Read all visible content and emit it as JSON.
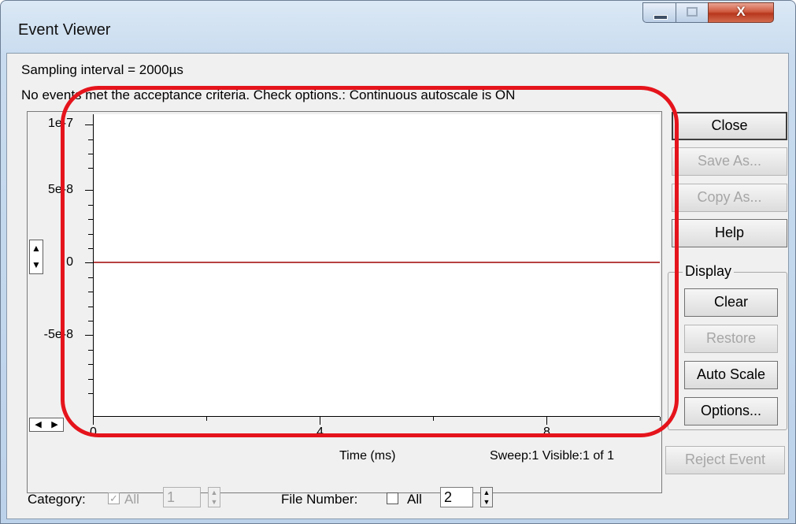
{
  "window": {
    "title": "Event Viewer",
    "close_glyph": "X"
  },
  "info": {
    "sampling_interval": "Sampling interval = 2000µs",
    "message": "No events met the acceptance criteria. Check options.:  Continuous autoscale is ON"
  },
  "plot": {
    "y_ticks": [
      "1e-7",
      "5e-8",
      "0",
      "-5e-8"
    ],
    "x_ticks": [
      "0",
      "4",
      "8"
    ],
    "x_axis_label": "Time (ms)",
    "trace_color": "#b74242"
  },
  "buttons": {
    "close": "Close",
    "save_as": "Save As...",
    "copy_as": "Copy As...",
    "help": "Help",
    "clear": "Clear",
    "restore": "Restore",
    "auto_scale": "Auto Scale",
    "options": "Options...",
    "reject_event": "Reject Event"
  },
  "display_group": {
    "label": "Display"
  },
  "status": {
    "sweep": "Sweep:1 Visible:1 of 1"
  },
  "bottom": {
    "category_label": "Category:",
    "category_all_label": "All",
    "category_value": "1",
    "file_number_label": "File Number:",
    "file_all_label": "All",
    "file_number_value": "2"
  },
  "spinners": {
    "up": "▲",
    "down": "▼",
    "left": "◀",
    "right": "▶"
  },
  "annotation_color": "#e5141c"
}
